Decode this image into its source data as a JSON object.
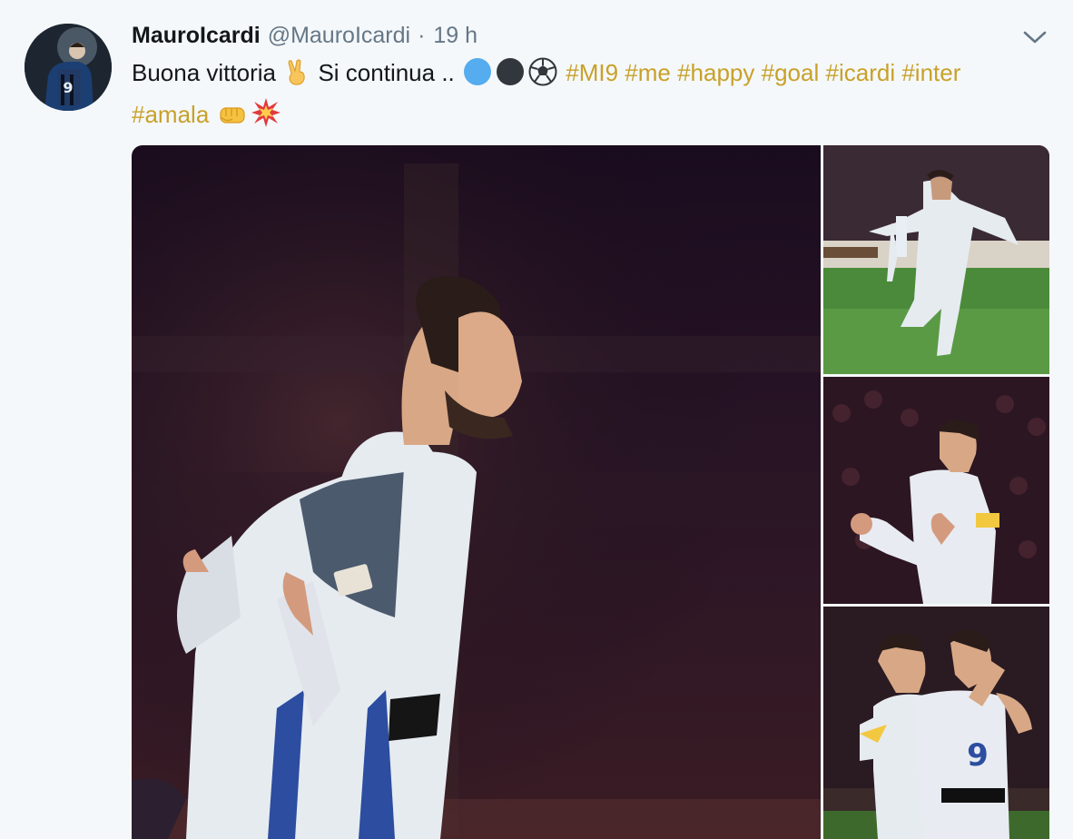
{
  "tweet": {
    "fullname": "MauroIcardi",
    "username": "@MauroIcardi",
    "separator": "·",
    "timestamp": "19 h",
    "caret_icon": "chevron-down-icon",
    "text": {
      "part1": "Buona vittoria",
      "part2": "Si continua ..",
      "hashtags_line1": [
        "#MI9",
        "#me",
        "#happy",
        "#goal",
        "#icardi",
        "#inter"
      ],
      "hashtags_line2": [
        "#amala"
      ]
    },
    "emojis": [
      "victory-hand-emoji",
      "blue-circle-emoji",
      "black-circle-emoji",
      "soccer-ball-emoji",
      "fist-emoji",
      "collision-emoji"
    ],
    "colors": {
      "hashtag": "#c8a12a",
      "name": "#14171a",
      "meta": "#657786",
      "background": "#f5f8fa"
    },
    "media": {
      "main_photo": "player-celebrating-arms-wide",
      "side_photos": [
        "player-running-on-pitch",
        "player-fists-clenched",
        "players-hugging"
      ]
    }
  }
}
